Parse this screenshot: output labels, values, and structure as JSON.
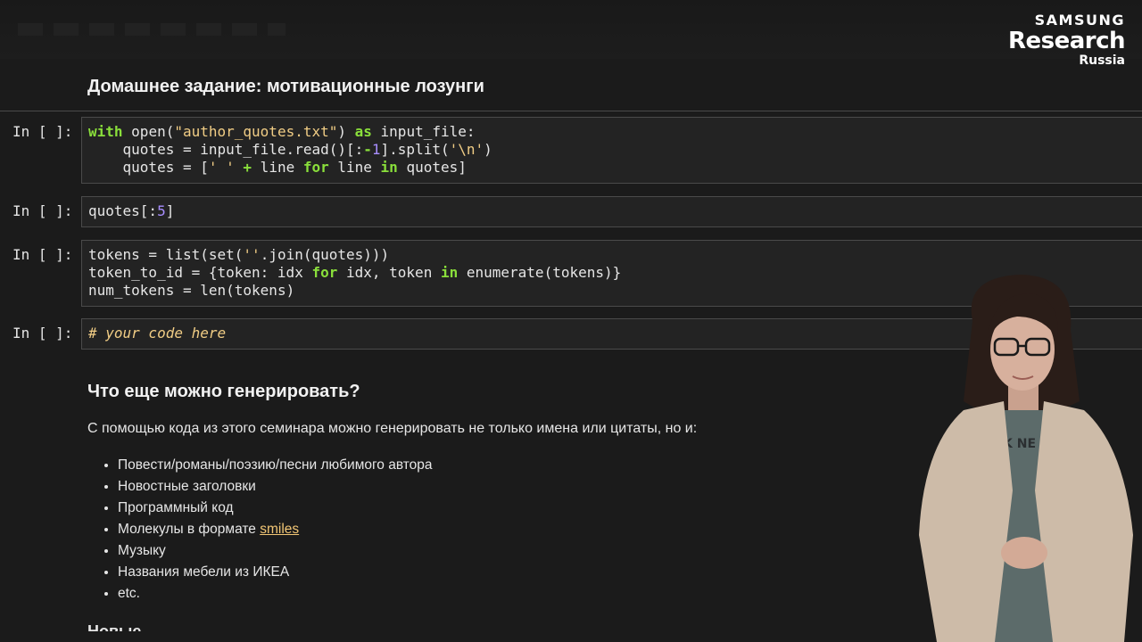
{
  "logo": {
    "line1": "SAMSUNG",
    "line2": "Research",
    "line3": "Russia"
  },
  "heading": "Домашнее задание: мотивационные лозунги",
  "cells": [
    {
      "prompt": "In [ ]:",
      "lines": [
        [
          [
            "kw",
            "with"
          ],
          [
            "t",
            " "
          ],
          [
            "fn",
            "open"
          ],
          [
            "t",
            "("
          ],
          [
            "str",
            "\"author_quotes.txt\""
          ],
          [
            "t",
            ") "
          ],
          [
            "kw",
            "as"
          ],
          [
            "t",
            " input_file:"
          ]
        ],
        [
          [
            "t",
            "    quotes = input_file.read()[:"
          ],
          [
            "op",
            "-"
          ],
          [
            "num",
            "1"
          ],
          [
            "t",
            "].split("
          ],
          [
            "str",
            "'\\n'"
          ],
          [
            "t",
            ")"
          ]
        ],
        [
          [
            "t",
            "    quotes = ["
          ],
          [
            "str",
            "' '"
          ],
          [
            "t",
            " "
          ],
          [
            "op",
            "+"
          ],
          [
            "t",
            " line "
          ],
          [
            "kw",
            "for"
          ],
          [
            "t",
            " line "
          ],
          [
            "kw",
            "in"
          ],
          [
            "t",
            " quotes]"
          ]
        ]
      ]
    },
    {
      "prompt": "In [ ]:",
      "lines": [
        [
          [
            "t",
            "quotes[:"
          ],
          [
            "num",
            "5"
          ],
          [
            "t",
            "]"
          ]
        ]
      ]
    },
    {
      "prompt": "In [ ]:",
      "lines": [
        [
          [
            "t",
            "tokens = "
          ],
          [
            "fn",
            "list"
          ],
          [
            "t",
            "("
          ],
          [
            "fn",
            "set"
          ],
          [
            "t",
            "("
          ],
          [
            "str",
            "''"
          ],
          [
            "t",
            ".join(quotes)))"
          ]
        ],
        [
          [
            "t",
            "token_to_id = {token: idx "
          ],
          [
            "kw",
            "for"
          ],
          [
            "t",
            " idx, token "
          ],
          [
            "kw",
            "in"
          ],
          [
            "t",
            " "
          ],
          [
            "fn",
            "enumerate"
          ],
          [
            "t",
            "(tokens)}"
          ]
        ],
        [
          [
            "t",
            "num_tokens = "
          ],
          [
            "fn",
            "len"
          ],
          [
            "t",
            "(tokens)"
          ]
        ]
      ]
    },
    {
      "prompt": "In [ ]:",
      "lines": [
        [
          [
            "cm",
            "# your code here"
          ]
        ]
      ]
    }
  ],
  "section2": {
    "title": "Что еще можно генерировать?",
    "intro": "С помощью кода из этого семинара можно генерировать не только имена или цитаты, но и:",
    "items": [
      {
        "text": "Повести/романы/поэзию/песни любимого автора"
      },
      {
        "text": "Новостные заголовки"
      },
      {
        "text": "Программный код"
      },
      {
        "text": "Молекулы в формате ",
        "link": "smiles"
      },
      {
        "text": "Музыку"
      },
      {
        "text": "Названия мебели из ИКЕА"
      },
      {
        "text": "etc."
      }
    ],
    "cutoff_text": "Новые"
  },
  "presenter": {
    "shirt_text": "K NE  OM"
  }
}
